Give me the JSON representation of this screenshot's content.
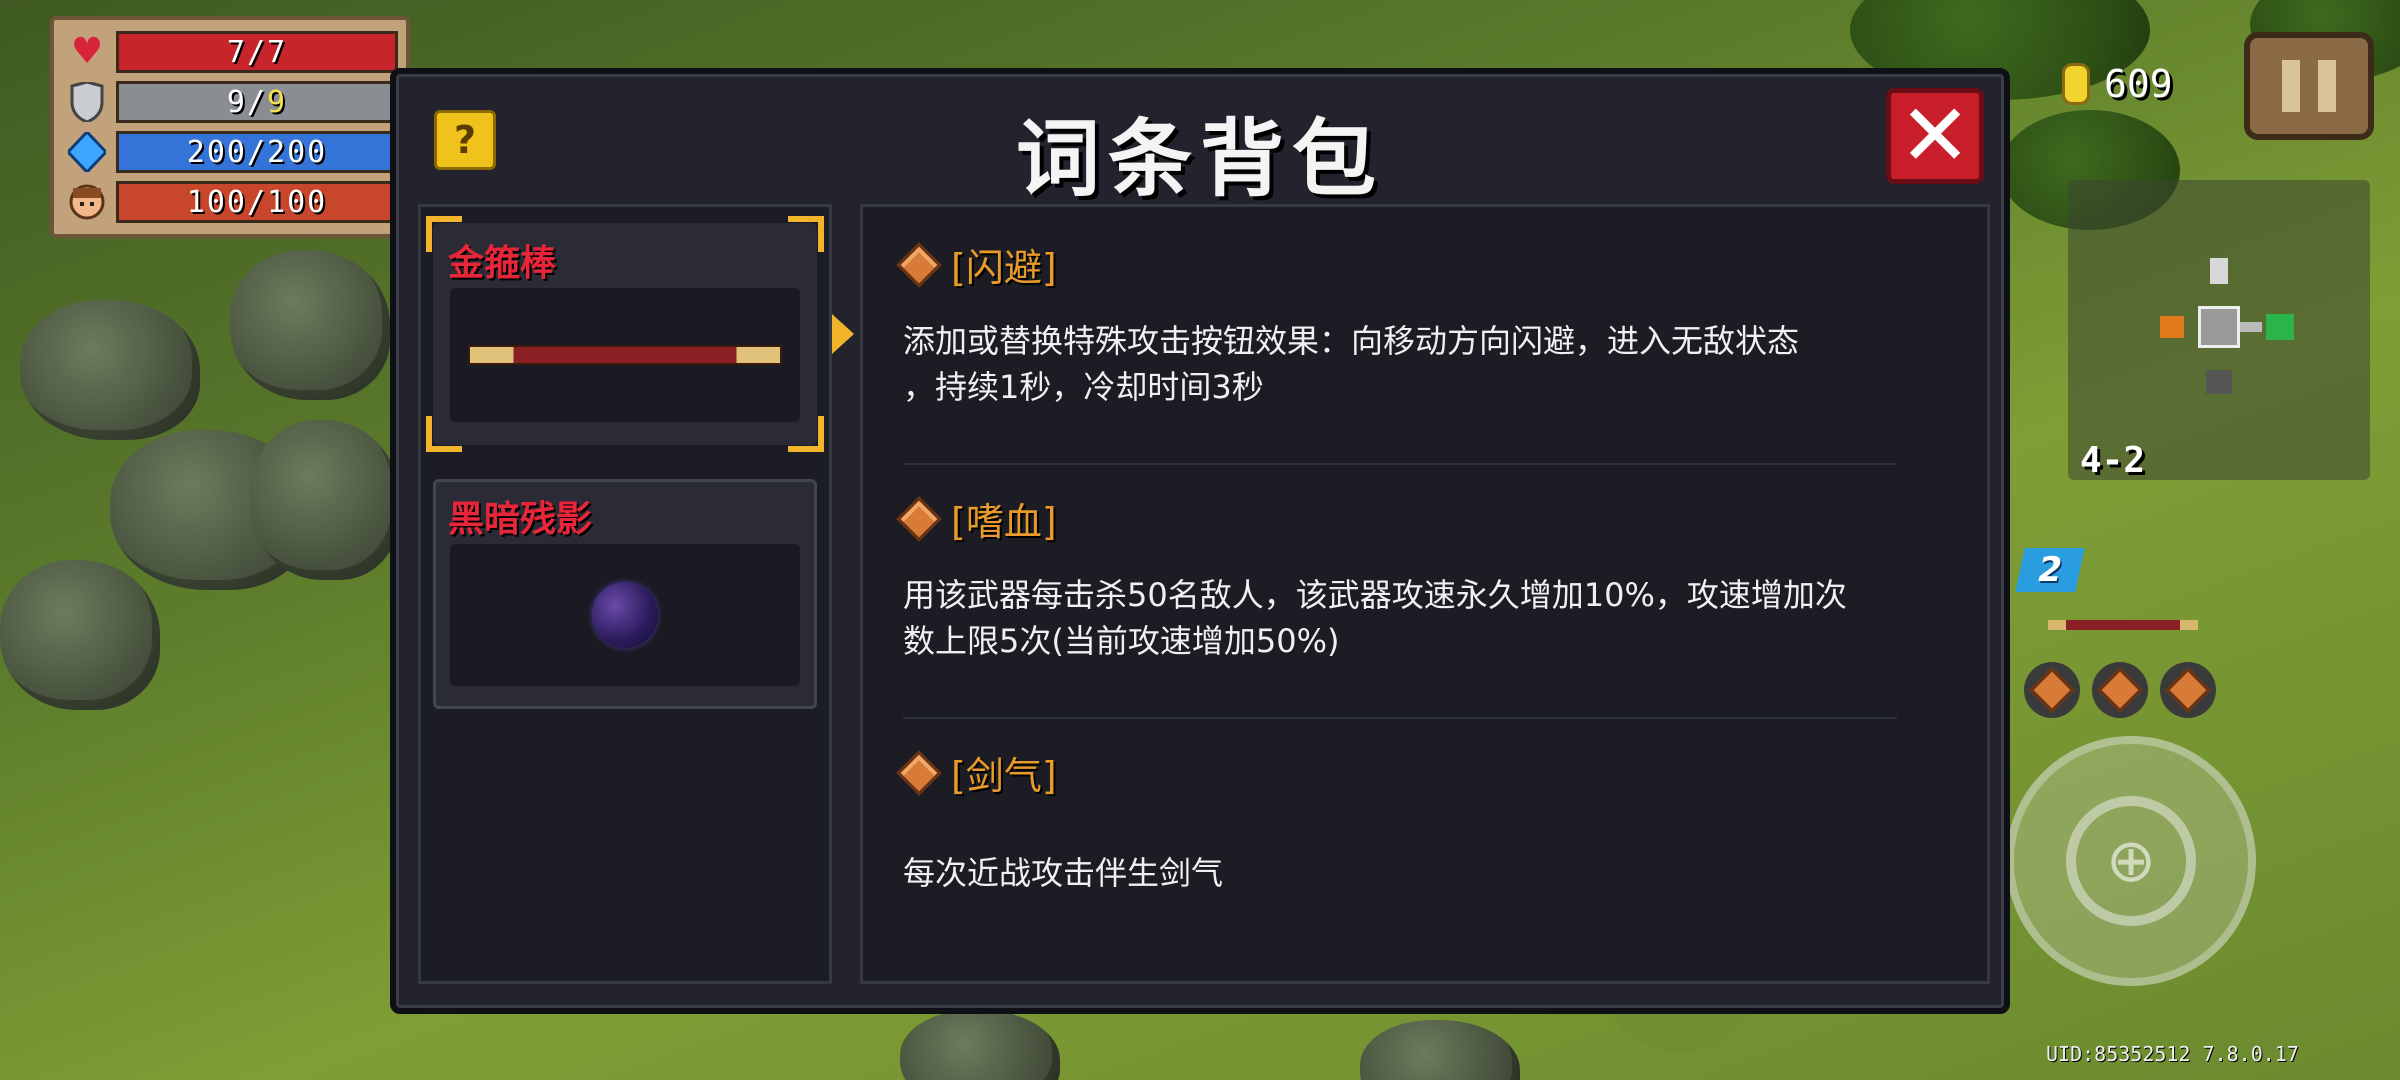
{
  "hud": {
    "hp": {
      "label": "7/7",
      "fill": 1.0,
      "color": "#c8242c"
    },
    "armor": {
      "label_main": "9/",
      "label_alt": "9",
      "fill": 1.0,
      "color": "#8a8e92"
    },
    "energy": {
      "label": "200/200",
      "fill": 1.0,
      "color": "#3474d8"
    },
    "extra": {
      "label": "100/100",
      "fill": 1.0,
      "color": "#c8462c"
    }
  },
  "coins": "609",
  "level": "4-2",
  "weapon_slot": "2",
  "uid": "UID:85352512 7.8.0.17",
  "modal": {
    "title": "词条背包",
    "help": "?",
    "close": "✕",
    "items": [
      {
        "name": "金箍棒",
        "icon": "staff"
      },
      {
        "name": "黑暗残影",
        "icon": "dark-orb"
      }
    ],
    "entries": [
      {
        "name": "[闪避]",
        "desc": "添加或替换特殊攻击按钮效果：向移动方向闪避，进入无敌状态\n，持续1秒，冷却时间3秒"
      },
      {
        "name": "[嗜血]",
        "desc": "用该武器每击杀50名敌人，该武器攻速永久增加10%，攻速增加次\n数上限5次(当前攻速增加50%)"
      },
      {
        "name": "[剑气]",
        "desc": "每次近战攻击伴生剑气"
      }
    ]
  }
}
